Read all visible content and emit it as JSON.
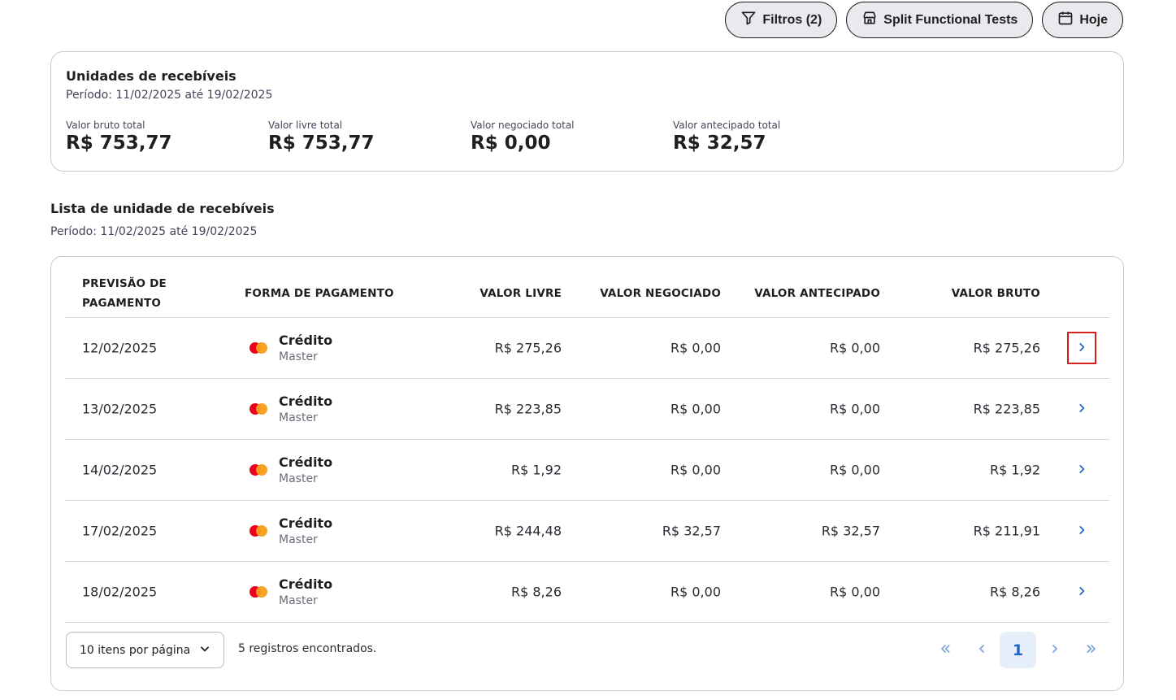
{
  "actions": {
    "filters_label": "Filtros (2)",
    "store_label": "Split Functional Tests",
    "date_label": "Hoje"
  },
  "summary": {
    "title": "Unidades de recebíveis",
    "period": "Período: 11/02/2025 até 19/02/2025",
    "totals": [
      {
        "label": "Valor bruto total",
        "value": "R$ 753,77"
      },
      {
        "label": "Valor livre total",
        "value": "R$ 753,77"
      },
      {
        "label": "Valor negociado total",
        "value": "R$ 0,00"
      },
      {
        "label": "Valor antecipado total",
        "value": "R$ 32,57"
      }
    ]
  },
  "list": {
    "title": "Lista de unidade de recebíveis",
    "period": "Período: 11/02/2025 até 19/02/2025",
    "headers": {
      "date_line1": "PREVISÃO DE",
      "date_line2": "PAGAMENTO",
      "payment": "FORMA DE PAGAMENTO",
      "free": "VALOR LIVRE",
      "negotiated": "VALOR NEGOCIADO",
      "anticipated": "VALOR ANTECIPADO",
      "gross": "VALOR BRUTO"
    },
    "rows": [
      {
        "date": "12/02/2025",
        "method": "Crédito",
        "brand": "Master",
        "free": "R$ 275,26",
        "negotiated": "R$ 0,00",
        "anticipated": "R$ 0,00",
        "gross": "R$ 275,26"
      },
      {
        "date": "13/02/2025",
        "method": "Crédito",
        "brand": "Master",
        "free": "R$ 223,85",
        "negotiated": "R$ 0,00",
        "anticipated": "R$ 0,00",
        "gross": "R$ 223,85"
      },
      {
        "date": "14/02/2025",
        "method": "Crédito",
        "brand": "Master",
        "free": "R$ 1,92",
        "negotiated": "R$ 0,00",
        "anticipated": "R$ 0,00",
        "gross": "R$ 1,92"
      },
      {
        "date": "17/02/2025",
        "method": "Crédito",
        "brand": "Master",
        "free": "R$ 244,48",
        "negotiated": "R$ 32,57",
        "anticipated": "R$ 32,57",
        "gross": "R$ 211,91"
      },
      {
        "date": "18/02/2025",
        "method": "Crédito",
        "brand": "Master",
        "free": "R$ 8,26",
        "negotiated": "R$ 0,00",
        "anticipated": "R$ 0,00",
        "gross": "R$ 8,26"
      }
    ]
  },
  "footer": {
    "per_page": "10 itens por página",
    "records": "5 registros encontrados.",
    "current_page": "1"
  },
  "colors": {
    "accent": "#1f66c9",
    "focus_outline": "#d42020",
    "mastercard_red": "#eb001b",
    "mastercard_orange": "#f79e1b"
  },
  "icons": [
    "filter-icon",
    "store-icon",
    "calendar-icon",
    "chevron-right-icon",
    "chevron-down-icon",
    "chevrons-left-icon",
    "chevron-left-icon",
    "chevrons-right-icon",
    "mastercard-logo"
  ]
}
